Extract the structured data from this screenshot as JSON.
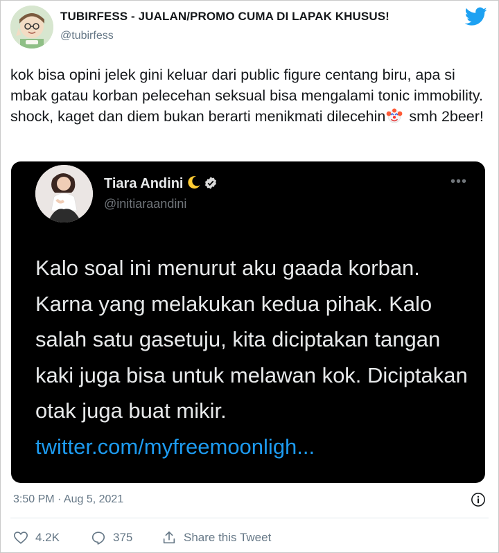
{
  "author": {
    "name": "TUBIRFESS - JUALAN/PROMO CUMA DI LAPAK KHUSUS!",
    "handle": "@tubirfess"
  },
  "tweet": {
    "text_before_emoji": "kok bisa opini jelek gini keluar dari public figure centang biru, apa si mbak gatau korban pelecehan seksual bisa mengalami tonic immobility. shock, kaget dan diem bukan berarti menikmati dilecehin",
    "text_after_emoji": " smh 2beer!",
    "emoji": "clown-face"
  },
  "embedded_tweet": {
    "name": "Tiara Andini",
    "handle": "@initiaraandini",
    "more_label": "•••",
    "text": "Kalo soal ini menurut aku gaada korban. Karna yang melakukan kedua pihak. Kalo salah satu gasetuju, kita diciptakan tangan kaki juga bisa untuk melawan kok. Diciptakan otak juga buat mikir.",
    "link": "twitter.com/myfreemoonligh..."
  },
  "meta": {
    "timestamp": "3:50 PM · Aug 5, 2021"
  },
  "actions": {
    "likes": "4.2K",
    "replies": "375",
    "share_label": "Share this Tweet"
  },
  "colors": {
    "twitter_blue": "#1da1f2",
    "link_blue": "#1d9bf0",
    "muted": "#657786",
    "dark_card": "#000000"
  },
  "icons": [
    "twitter-bird-icon",
    "clown-emoji",
    "moon-emoji",
    "verified-badge-icon",
    "more-icon",
    "info-icon",
    "heart-icon",
    "reply-icon",
    "share-icon"
  ]
}
